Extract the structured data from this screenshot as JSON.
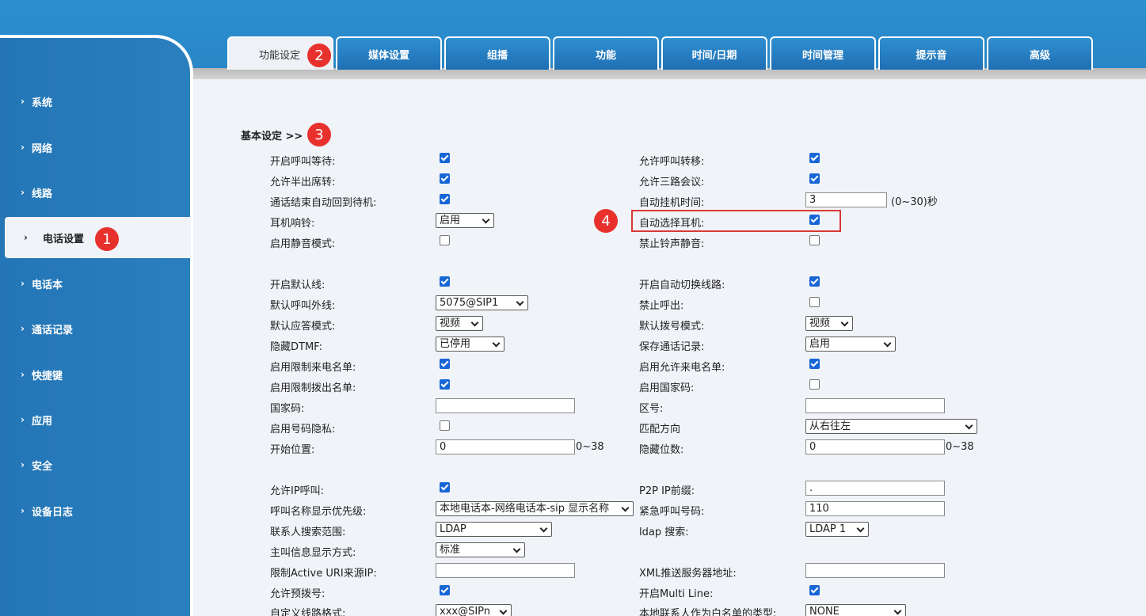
{
  "sidebar": {
    "items": [
      {
        "label": "系统"
      },
      {
        "label": "网络"
      },
      {
        "label": "线路"
      },
      {
        "label": "电话设置",
        "active": true
      },
      {
        "label": "电话本"
      },
      {
        "label": "通话记录"
      },
      {
        "label": "快捷键"
      },
      {
        "label": "应用"
      },
      {
        "label": "安全"
      },
      {
        "label": "设备日志"
      }
    ]
  },
  "tabs": [
    "功能设定",
    "媒体设置",
    "组播",
    "功能",
    "时间/日期",
    "时间管理",
    "提示音",
    "高级"
  ],
  "badges": {
    "b1": "1",
    "b2": "2",
    "b3": "3",
    "b4": "4"
  },
  "section_title": "基本设定 >>",
  "fields": {
    "call_waiting": {
      "label": "开启呼叫等待:",
      "checked": true
    },
    "allow_forward": {
      "label": "允许呼叫转移:",
      "checked": true
    },
    "semi_transfer": {
      "label": "允许半出席转:",
      "checked": true
    },
    "three_way": {
      "label": "允许三路会议:",
      "checked": true
    },
    "auto_idle": {
      "label": "通话结束自动回到待机:",
      "checked": true
    },
    "auto_hangup": {
      "label": "自动挂机时间:",
      "value": "3",
      "hint": "(0~30)秒"
    },
    "headset_ring": {
      "label": "耳机响铃:",
      "value": "启用"
    },
    "auto_headset": {
      "label": "自动选择耳机:",
      "checked": true
    },
    "silent_mode": {
      "label": "启用静音模式:",
      "checked": false
    },
    "no_ring_mute": {
      "label": "禁止铃声静音:",
      "checked": false
    },
    "default_line": {
      "label": "开启默认线:",
      "checked": true
    },
    "auto_switch_line": {
      "label": "开启自动切换线路:",
      "checked": true
    },
    "default_out_line": {
      "label": "默认呼叫外线:",
      "value": "5075@SIP1"
    },
    "no_outgoing": {
      "label": "禁止呼出:",
      "checked": false
    },
    "answer_mode": {
      "label": "默认应答模式:",
      "value": "视频"
    },
    "dial_mode": {
      "label": "默认拨号模式:",
      "value": "视频"
    },
    "hide_dtmf": {
      "label": "隐藏DTMF:",
      "value": "已停用"
    },
    "save_call_log": {
      "label": "保存通话记录:",
      "value": "启用"
    },
    "restrict_incoming": {
      "label": "启用限制来电名单:",
      "checked": true
    },
    "allow_incoming": {
      "label": "启用允许来电名单:",
      "checked": true
    },
    "restrict_outgoing": {
      "label": "启用限制拨出名单:",
      "checked": true
    },
    "country_code_enable": {
      "label": "启用国家码:",
      "checked": false
    },
    "country_code": {
      "label": "国家码:",
      "value": ""
    },
    "area_code": {
      "label": "区号:",
      "value": ""
    },
    "number_privacy": {
      "label": "启用号码隐私:",
      "checked": false
    },
    "match_direction": {
      "label": "匹配方向",
      "value": "从右往左"
    },
    "start_pos": {
      "label": "开始位置:",
      "value": "0",
      "hint": "0~38"
    },
    "hide_digits": {
      "label": "隐藏位数:",
      "value": "0",
      "hint": "0~38"
    },
    "allow_ip_call": {
      "label": "允许IP呼叫:",
      "checked": true
    },
    "p2p_prefix": {
      "label": "P2P IP前缀:",
      "value": "."
    },
    "name_priority": {
      "label": "呼叫名称显示优先级:",
      "value": "本地电话本-网络电话本-sip 显示名称"
    },
    "emergency": {
      "label": "紧急呼叫号码:",
      "value": "110"
    },
    "contact_scope": {
      "label": "联系人搜索范围:",
      "value": "LDAP"
    },
    "ldap_search": {
      "label": "ldap 搜索:",
      "value": "LDAP 1"
    },
    "caller_display": {
      "label": "主叫信息显示方式:",
      "value": "标准"
    },
    "active_uri": {
      "label": "限制Active URI来源IP:",
      "value": ""
    },
    "xml_server": {
      "label": "XML推送服务器地址:",
      "value": ""
    },
    "pre_dial": {
      "label": "允许预拨号:",
      "checked": true
    },
    "multi_line": {
      "label": "开启Multi Line:",
      "checked": true
    },
    "custom_line_format": {
      "label": "自定义线路格式:",
      "value": "xxx@SIPn"
    },
    "whitelist_type": {
      "label": "本地联系人作为白名单的类型:",
      "value": "NONE"
    }
  }
}
